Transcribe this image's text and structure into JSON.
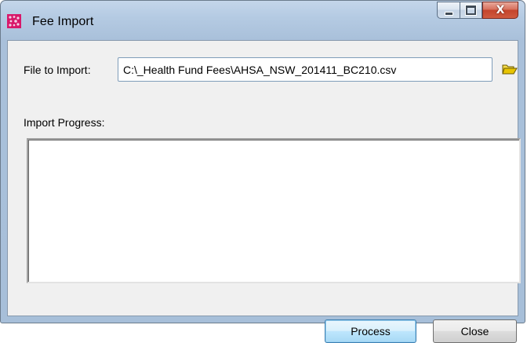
{
  "window": {
    "title": "Fee Import",
    "icon": "app-icon"
  },
  "caption_buttons": {
    "minimize": "minimize-icon",
    "maximize": "maximize-icon",
    "close_glyph": "X"
  },
  "form": {
    "file_label": "File to Import:",
    "file_value": "C:\\_Health Fund Fees\\AHSA_NSW_201411_BC210.csv",
    "browse_icon": "folder-open-icon",
    "progress_label": "Import Progress:",
    "progress_text": ""
  },
  "buttons": {
    "process": "Process",
    "close": "Close"
  },
  "colors": {
    "frame": "#b5cbe3",
    "close_button": "#c4442c",
    "default_button_border": "#3c7fb1",
    "folder": "#e8c400"
  }
}
